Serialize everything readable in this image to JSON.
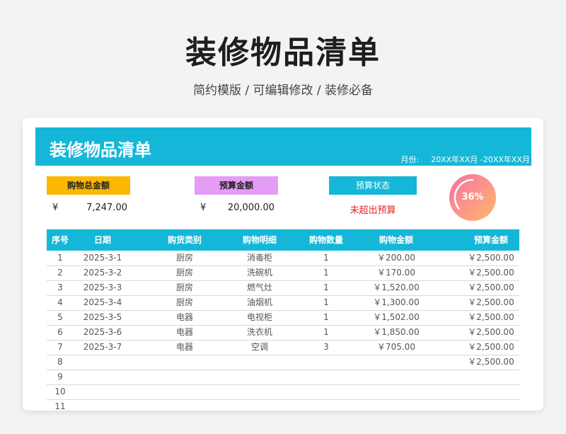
{
  "header": {
    "title": "装修物品清单",
    "subtitle": "简约模版 / 可编辑修改 / 装修必备"
  },
  "card": {
    "banner_title": "装修物品清单",
    "month_label": "月份:",
    "month_value": "20XX年XX月 -20XX年XX月"
  },
  "kpis": {
    "total_label": "购物总金额",
    "total_currency": "¥",
    "total_value": "7,247.00",
    "budget_label": "预算金额",
    "budget_currency": "¥",
    "budget_value": "20,000.00",
    "status_label": "预算状态",
    "status_value": "未超出预算",
    "progress_percent": 36,
    "progress_label": "36%"
  },
  "colors": {
    "accent": "#14b7d7",
    "total_label_bg": "#fbb800",
    "budget_label_bg": "#e59cf6",
    "status_text": "#e8202a",
    "ring_start": "#fa6fa4",
    "ring_end": "#fdb96d"
  },
  "table": {
    "columns": [
      "序号",
      "日期",
      "购货类别",
      "购物明细",
      "购物数量",
      "购物金额",
      "预算金额"
    ],
    "rows": [
      [
        "1",
        "2025-3-1",
        "厨房",
        "消毒柜",
        "1",
        "￥200.00",
        "￥2,500.00"
      ],
      [
        "2",
        "2025-3-2",
        "厨房",
        "洗碗机",
        "1",
        "￥170.00",
        "￥2,500.00"
      ],
      [
        "3",
        "2025-3-3",
        "厨房",
        "燃气灶",
        "1",
        "￥1,520.00",
        "￥2,500.00"
      ],
      [
        "4",
        "2025-3-4",
        "厨房",
        "油烟机",
        "1",
        "￥1,300.00",
        "￥2,500.00"
      ],
      [
        "5",
        "2025-3-5",
        "电器",
        "电视柜",
        "1",
        "￥1,502.00",
        "￥2,500.00"
      ],
      [
        "6",
        "2025-3-6",
        "电器",
        "洗衣机",
        "1",
        "￥1,850.00",
        "￥2,500.00"
      ],
      [
        "7",
        "2025-3-7",
        "电器",
        "空调",
        "3",
        "￥705.00",
        "￥2,500.00"
      ],
      [
        "8",
        "",
        "",
        "",
        "",
        "",
        "￥2,500.00"
      ],
      [
        "9",
        "",
        "",
        "",
        "",
        "",
        ""
      ],
      [
        "10",
        "",
        "",
        "",
        "",
        "",
        ""
      ],
      [
        "11",
        "",
        "",
        "",
        "",
        "",
        ""
      ]
    ]
  }
}
